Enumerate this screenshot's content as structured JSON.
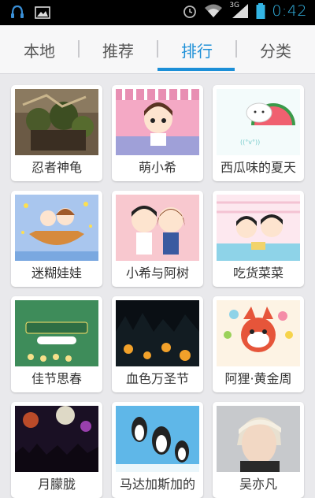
{
  "status_bar": {
    "time": "0:42",
    "signal_label": "3G"
  },
  "tabs": [
    {
      "label": "本地",
      "active": false
    },
    {
      "label": "推荐",
      "active": false
    },
    {
      "label": "排行",
      "active": true
    },
    {
      "label": "分类",
      "active": false
    }
  ],
  "accent_color": "#1c8fd7",
  "grid": {
    "items": [
      {
        "title": "忍者神龟",
        "thumb": "teenage-mutant-ninja-turtles-theme"
      },
      {
        "title": "萌小希",
        "thumb": "cute-cartoon-girl-theme"
      },
      {
        "title": "西瓜味的夏天",
        "thumb": "watermelon-cat-theme"
      },
      {
        "title": "迷糊娃娃",
        "thumb": "cartoon-couple-boat-theme"
      },
      {
        "title": "小希与阿树",
        "thumb": "cartoon-couple-theme"
      },
      {
        "title": "吃货菜菜",
        "thumb": "cartoon-foodie-theme"
      },
      {
        "title": "佳节思春",
        "thumb": "festival-green-theme"
      },
      {
        "title": "血色万圣节",
        "thumb": "halloween-pumpkins-theme"
      },
      {
        "title": "阿狸·黄金周",
        "thumb": "ali-fox-golden-week-theme"
      },
      {
        "title": "月朦胧",
        "thumb": "night-fireworks-theme"
      },
      {
        "title": "马达加斯加的",
        "thumb": "madagascar-penguins-theme"
      },
      {
        "title": "吴亦凡",
        "thumb": "celebrity-portrait-theme"
      }
    ]
  }
}
